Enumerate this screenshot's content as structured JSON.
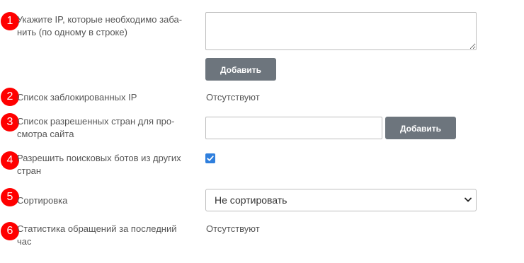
{
  "rows": [
    {
      "number": "1",
      "label": "Укажите IP, которые необходимо заба-нить (по одному в строке)",
      "label_line1": "Укажите IP, которые необходимо заба-",
      "label_line2": "нить (по одному в строке)"
    },
    {
      "number": "2",
      "label": "Список заблокированных IP",
      "value": "Отсутствуют"
    },
    {
      "number": "3",
      "label_line1": "Список разрешенных стран для про-",
      "label_line2": "смотра сайта"
    },
    {
      "number": "4",
      "label_line1": "Разрешить поисковых ботов из других",
      "label_line2": "стран",
      "checked": true
    },
    {
      "number": "5",
      "label": "Сортировка",
      "select_value": "Не сортировать"
    },
    {
      "number": "6",
      "label_line1": "Статистика обращений за последний",
      "label_line2": "час",
      "value": "Отсутствуют"
    }
  ],
  "buttons": {
    "add_ip": "Добавить",
    "add_country": "Добавить"
  },
  "icons": {
    "checkbox": "checkmark-icon",
    "select": "chevron-down-icon"
  },
  "colors": {
    "badge": "#ff0000",
    "button": "#6d757d",
    "checkbox": "#2f7fdd"
  }
}
